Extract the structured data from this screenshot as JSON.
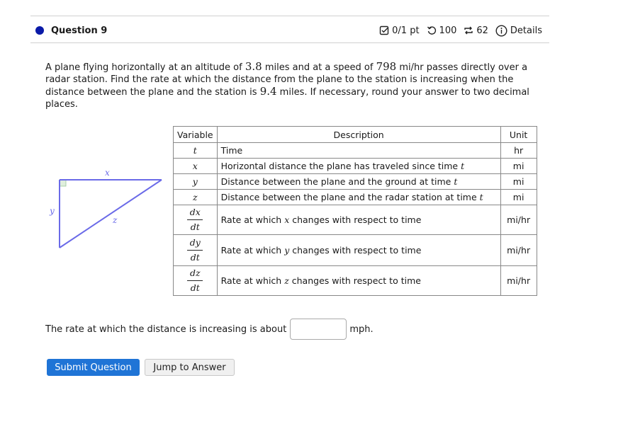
{
  "header": {
    "title": "Question 9",
    "score": "0/1 pt",
    "attempts": "100",
    "retries": "62",
    "details_label": "Details",
    "icons": {
      "score": "checkbox-icon",
      "attempts": "undo-icon",
      "retries": "repeat-icon",
      "details": "info-icon"
    }
  },
  "problem": {
    "p1": "A plane flying horizontally at an altitude of ",
    "altitude": "3.8",
    "p2": " miles and at a speed of ",
    "speed": "798",
    "p3": " mi/hr passes directly over a radar station. Find the rate at which the distance from the plane to the station is increasing when the distance between the plane and the station is ",
    "distance": "9.4",
    "p4": " miles. If necessary, round your answer to two decimal places."
  },
  "diagram": {
    "label_x": "x",
    "label_y": "y",
    "label_z": "z"
  },
  "table": {
    "headers": [
      "Variable",
      "Description",
      "Unit"
    ],
    "rows": [
      {
        "var": "t",
        "desc": "Time",
        "desc_var": "",
        "desc_tail": "",
        "unit": "hr"
      },
      {
        "var": "x",
        "desc": "Horizontal distance the plane has traveled since time ",
        "desc_var": "t",
        "desc_tail": "",
        "unit": "mi"
      },
      {
        "var": "y",
        "desc": "Distance between the plane and the ground at time ",
        "desc_var": "t",
        "desc_tail": "",
        "unit": "mi"
      },
      {
        "var": "z",
        "desc": "Distance between the plane and the radar station at time ",
        "desc_var": "t",
        "desc_tail": "",
        "unit": "mi"
      },
      {
        "num": "dx",
        "den": "dt",
        "desc": "Rate at which ",
        "desc_var": "x",
        "desc_tail": " changes with respect to time",
        "unit": "mi/hr"
      },
      {
        "num": "dy",
        "den": "dt",
        "desc": "Rate at which ",
        "desc_var": "y",
        "desc_tail": " changes with respect to time",
        "unit": "mi/hr"
      },
      {
        "num": "dz",
        "den": "dt",
        "desc": "Rate at which ",
        "desc_var": "z",
        "desc_tail": " changes with respect to time",
        "unit": "mi/hr"
      }
    ]
  },
  "answer": {
    "prefix": "The rate at which the distance is increasing is about",
    "value": "",
    "suffix": "mph."
  },
  "buttons": {
    "submit": "Submit Question",
    "jump": "Jump to Answer"
  }
}
